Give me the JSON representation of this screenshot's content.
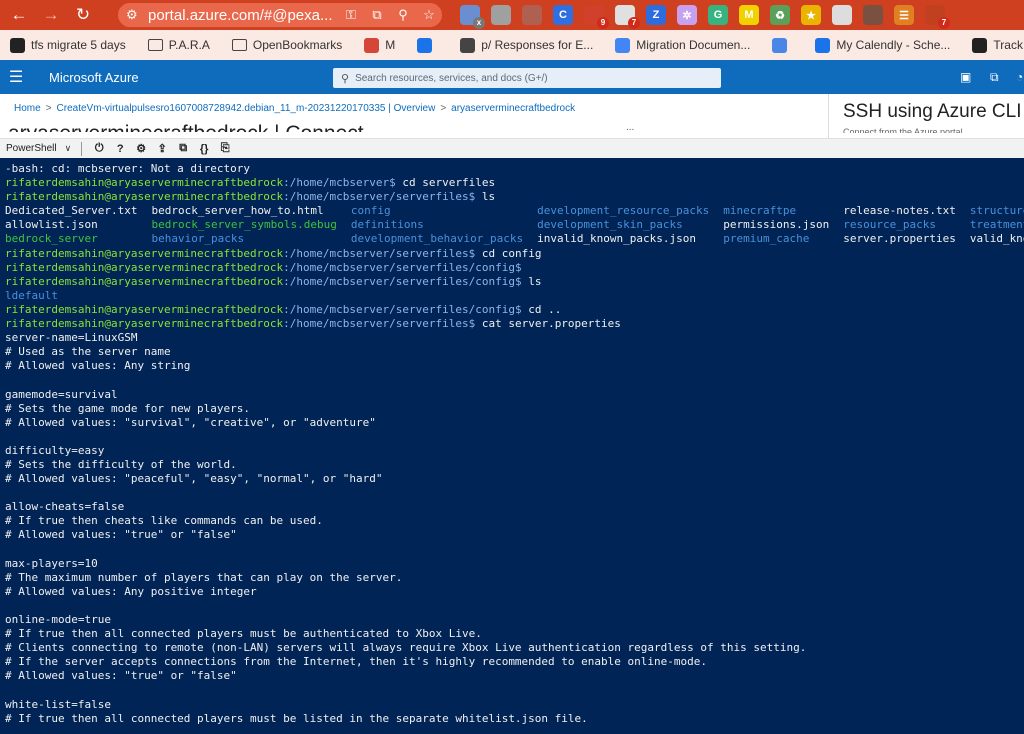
{
  "browser": {
    "url": "portal.azure.com/#@pexa...",
    "extensions": [
      {
        "name": "ext-blue",
        "color": "#6b8ed0",
        "glyph": "",
        "badge": "x"
      },
      {
        "name": "ext-gray-grid",
        "color": "#a0a0a0",
        "glyph": "",
        "badge": ""
      },
      {
        "name": "ext-camera",
        "color": "#b06050",
        "glyph": "",
        "badge": ""
      },
      {
        "name": "ext-chrome",
        "color": "#2f6fe0",
        "glyph": "C",
        "badge": ""
      },
      {
        "name": "ext-red-dots",
        "color": "#d0402a",
        "glyph": "",
        "badge": "9"
      },
      {
        "name": "ext-tag",
        "color": "#e0e0e0",
        "glyph": "",
        "badge": "7"
      },
      {
        "name": "ext-z",
        "color": "#2d6cdf",
        "glyph": "Z",
        "badge": ""
      },
      {
        "name": "ext-flower",
        "color": "#c8a0f0",
        "glyph": "✲",
        "badge": ""
      },
      {
        "name": "ext-g",
        "color": "#36b37e",
        "glyph": "G",
        "badge": ""
      },
      {
        "name": "ext-m",
        "color": "#f2d100",
        "glyph": "M",
        "badge": ""
      },
      {
        "name": "ext-recycle",
        "color": "#5aa05a",
        "glyph": "♻",
        "badge": ""
      },
      {
        "name": "ext-star",
        "color": "#e9b300",
        "glyph": "★",
        "badge": ""
      },
      {
        "name": "ext-window",
        "color": "#dddddd",
        "glyph": "",
        "badge": ""
      },
      {
        "name": "ext-photo",
        "color": "#7a5040",
        "glyph": "",
        "badge": ""
      },
      {
        "name": "ext-menu",
        "color": "#e08020",
        "glyph": "☰",
        "badge": ""
      },
      {
        "name": "ext-puzzle",
        "color": "#c04020",
        "glyph": "",
        "badge": "7"
      }
    ]
  },
  "bookmarks": [
    {
      "label": "tfs migrate 5 days",
      "icon": "github-icon",
      "color": "#222222"
    },
    {
      "label": "P.A.R.A",
      "icon": "folder-icon",
      "color": ""
    },
    {
      "label": "OpenBookmarks",
      "icon": "folder-icon",
      "color": ""
    },
    {
      "label": "M",
      "icon": "gmail-icon",
      "color": "#d44638"
    },
    {
      "label": "",
      "icon": "calendar-icon",
      "color": "#1a73e8"
    },
    {
      "label": "p/ Responses for E...",
      "icon": "clock-icon",
      "color": "#444444"
    },
    {
      "label": "Migration Documen...",
      "icon": "docs-icon",
      "color": "#4285f4"
    },
    {
      "label": "",
      "icon": "check-icon",
      "color": "#4a86e8"
    },
    {
      "label": "My Calendly - Sche...",
      "icon": "calendly-icon",
      "color": "#1a73e8"
    },
    {
      "label": "Track Package",
      "icon": "amazon-icon",
      "color": "#222222"
    }
  ],
  "azure": {
    "brand": "Microsoft Azure",
    "search_placeholder": "Search resources, services, and docs (G+/)"
  },
  "breadcrumb": {
    "items": [
      "Home",
      "CreateVm-virtualpulsesro1607008728942.debian_11_m-20231220170335 | Overview",
      "aryaserverminecraftbedrock"
    ],
    "page_title_partial": "aryaserverminecraftbedrock | Connect",
    "ellipsis": "..."
  },
  "ssh_panel": {
    "title": "SSH using Azure CLI",
    "subtitle": "Connect from the Azure portal"
  },
  "shell": {
    "selected": "PowerShell",
    "tools": [
      "power-icon",
      "help-icon",
      "settings-icon",
      "upload-icon",
      "new-session-icon",
      "braces-icon",
      "web-preview-icon"
    ]
  },
  "terminal": {
    "user": "rifaterdemsahin@aryaserverminecraftbedrock",
    "lines_before": [
      {
        "text": "-bash: cd: mcbserver: Not a directory"
      },
      {
        "prompt": ":/home/mcbserver$",
        "cmd": " cd serverfiles"
      },
      {
        "prompt": ":/home/mcbserver/serverfiles$",
        "cmd": " ls"
      }
    ],
    "ls_columns": [
      [
        {
          "t": "Dedicated_Server.txt",
          "c": ""
        },
        {
          "t": "allowlist.json",
          "c": ""
        },
        {
          "t": "bedrock_server",
          "c": "g"
        }
      ],
      [
        {
          "t": "bedrock_server_how_to.html",
          "c": ""
        },
        {
          "t": "bedrock_server_symbols.debug",
          "c": "g"
        },
        {
          "t": "behavior_packs",
          "c": "d"
        }
      ],
      [
        {
          "t": "config",
          "c": "d"
        },
        {
          "t": "definitions",
          "c": "d"
        },
        {
          "t": "development_behavior_packs",
          "c": "d"
        }
      ],
      [
        {
          "t": "development_resource_packs",
          "c": "d"
        },
        {
          "t": "development_skin_packs",
          "c": "d"
        },
        {
          "t": "invalid_known_packs.json",
          "c": ""
        }
      ],
      [
        {
          "t": "minecraftpe",
          "c": "d"
        },
        {
          "t": "permissions.json",
          "c": ""
        },
        {
          "t": "premium_cache",
          "c": "d"
        }
      ],
      [
        {
          "t": "release-notes.txt",
          "c": ""
        },
        {
          "t": "resource_packs",
          "c": "d"
        },
        {
          "t": "server.properties",
          "c": ""
        }
      ],
      [
        {
          "t": "structures",
          "c": "d"
        },
        {
          "t": "treatments",
          "c": "d"
        },
        {
          "t": "valid_known",
          "c": ""
        }
      ]
    ],
    "lines_after": [
      {
        "prompt": ":/home/mcbserver/serverfiles$",
        "cmd": " cd config"
      },
      {
        "prompt": ":/home/mcbserver/serverfiles/config$",
        "cmd": ""
      },
      {
        "prompt": ":/home/mcbserver/serverfiles/config$",
        "cmd": " ls"
      },
      {
        "text": "ldefault",
        "c": "d"
      },
      {
        "prompt": ":/home/mcbserver/serverfiles/config$",
        "cmd": " cd .."
      },
      {
        "prompt": ":/home/mcbserver/serverfiles$",
        "cmd": " cat server.properties"
      },
      {
        "text": "server-name=LinuxGSM"
      },
      {
        "text": "# Used as the server name"
      },
      {
        "text": "# Allowed values: Any string"
      },
      {
        "text": ""
      },
      {
        "text": "gamemode=survival"
      },
      {
        "text": "# Sets the game mode for new players."
      },
      {
        "text": "# Allowed values: \"survival\", \"creative\", or \"adventure\""
      },
      {
        "text": ""
      },
      {
        "text": "difficulty=easy"
      },
      {
        "text": "# Sets the difficulty of the world."
      },
      {
        "text": "# Allowed values: \"peaceful\", \"easy\", \"normal\", or \"hard\""
      },
      {
        "text": ""
      },
      {
        "text": "allow-cheats=false"
      },
      {
        "text": "# If true then cheats like commands can be used."
      },
      {
        "text": "# Allowed values: \"true\" or \"false\""
      },
      {
        "text": ""
      },
      {
        "text": "max-players=10"
      },
      {
        "text": "# The maximum number of players that can play on the server."
      },
      {
        "text": "# Allowed values: Any positive integer"
      },
      {
        "text": ""
      },
      {
        "text": "online-mode=true"
      },
      {
        "text": "# If true then all connected players must be authenticated to Xbox Live."
      },
      {
        "text": "# Clients connecting to remote (non-LAN) servers will always require Xbox Live authentication regardless of this setting."
      },
      {
        "text": "# If the server accepts connections from the Internet, then it's highly recommended to enable online-mode."
      },
      {
        "text": "# Allowed values: \"true\" or \"false\""
      },
      {
        "text": ""
      },
      {
        "text": "white-list=false"
      },
      {
        "text": "# If true then all connected players must be listed in the separate whitelist.json file."
      }
    ]
  }
}
